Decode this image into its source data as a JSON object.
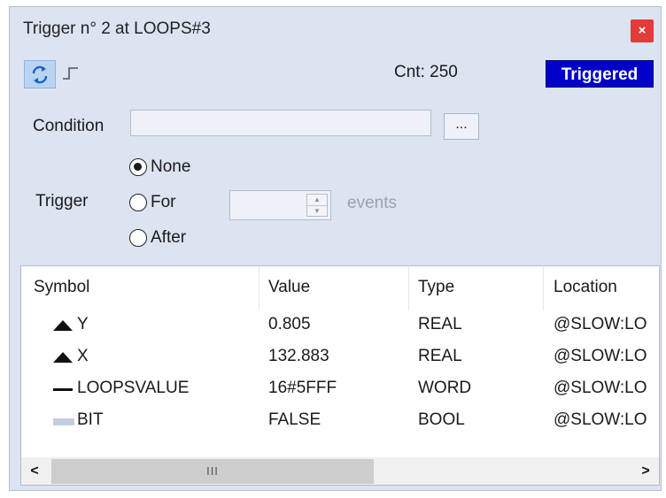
{
  "window": {
    "title": "Trigger n° 2 at LOOPS#3",
    "close_label": "×"
  },
  "toolbar": {
    "refresh_icon": "refresh-icon",
    "edge_icon": "rising-edge-icon",
    "count_text": "Cnt: 250",
    "status": "Triggered",
    "status_color": "#0000c8"
  },
  "form": {
    "condition_label": "Condition",
    "condition_value": "",
    "browse_label": "...",
    "trigger_label": "Trigger",
    "options": [
      {
        "label": "None",
        "checked": true
      },
      {
        "label": "For",
        "checked": false
      },
      {
        "label": "After",
        "checked": false
      }
    ],
    "count_value": "",
    "events_label": "events"
  },
  "table": {
    "columns": [
      "Symbol",
      "Value",
      "Type",
      "Location"
    ],
    "rows": [
      {
        "icon": "triangle-up-icon",
        "symbol": "Y",
        "value": "0.805",
        "type": "REAL",
        "location": "@SLOW:LO"
      },
      {
        "icon": "triangle-up-icon",
        "symbol": "X",
        "value": "132.883",
        "type": "REAL",
        "location": "@SLOW:LO"
      },
      {
        "icon": "dash-icon",
        "symbol": "LOOPSVALUE",
        "value": "16#5FFF",
        "type": "WORD",
        "location": "@SLOW:LO"
      },
      {
        "icon": "bar-icon",
        "symbol": "BIT",
        "value": "FALSE",
        "type": "BOOL",
        "location": "@SLOW:LO"
      }
    ]
  },
  "scrollbar": {
    "left_arrow": "<",
    "right_arrow": ">",
    "grip": "III"
  }
}
